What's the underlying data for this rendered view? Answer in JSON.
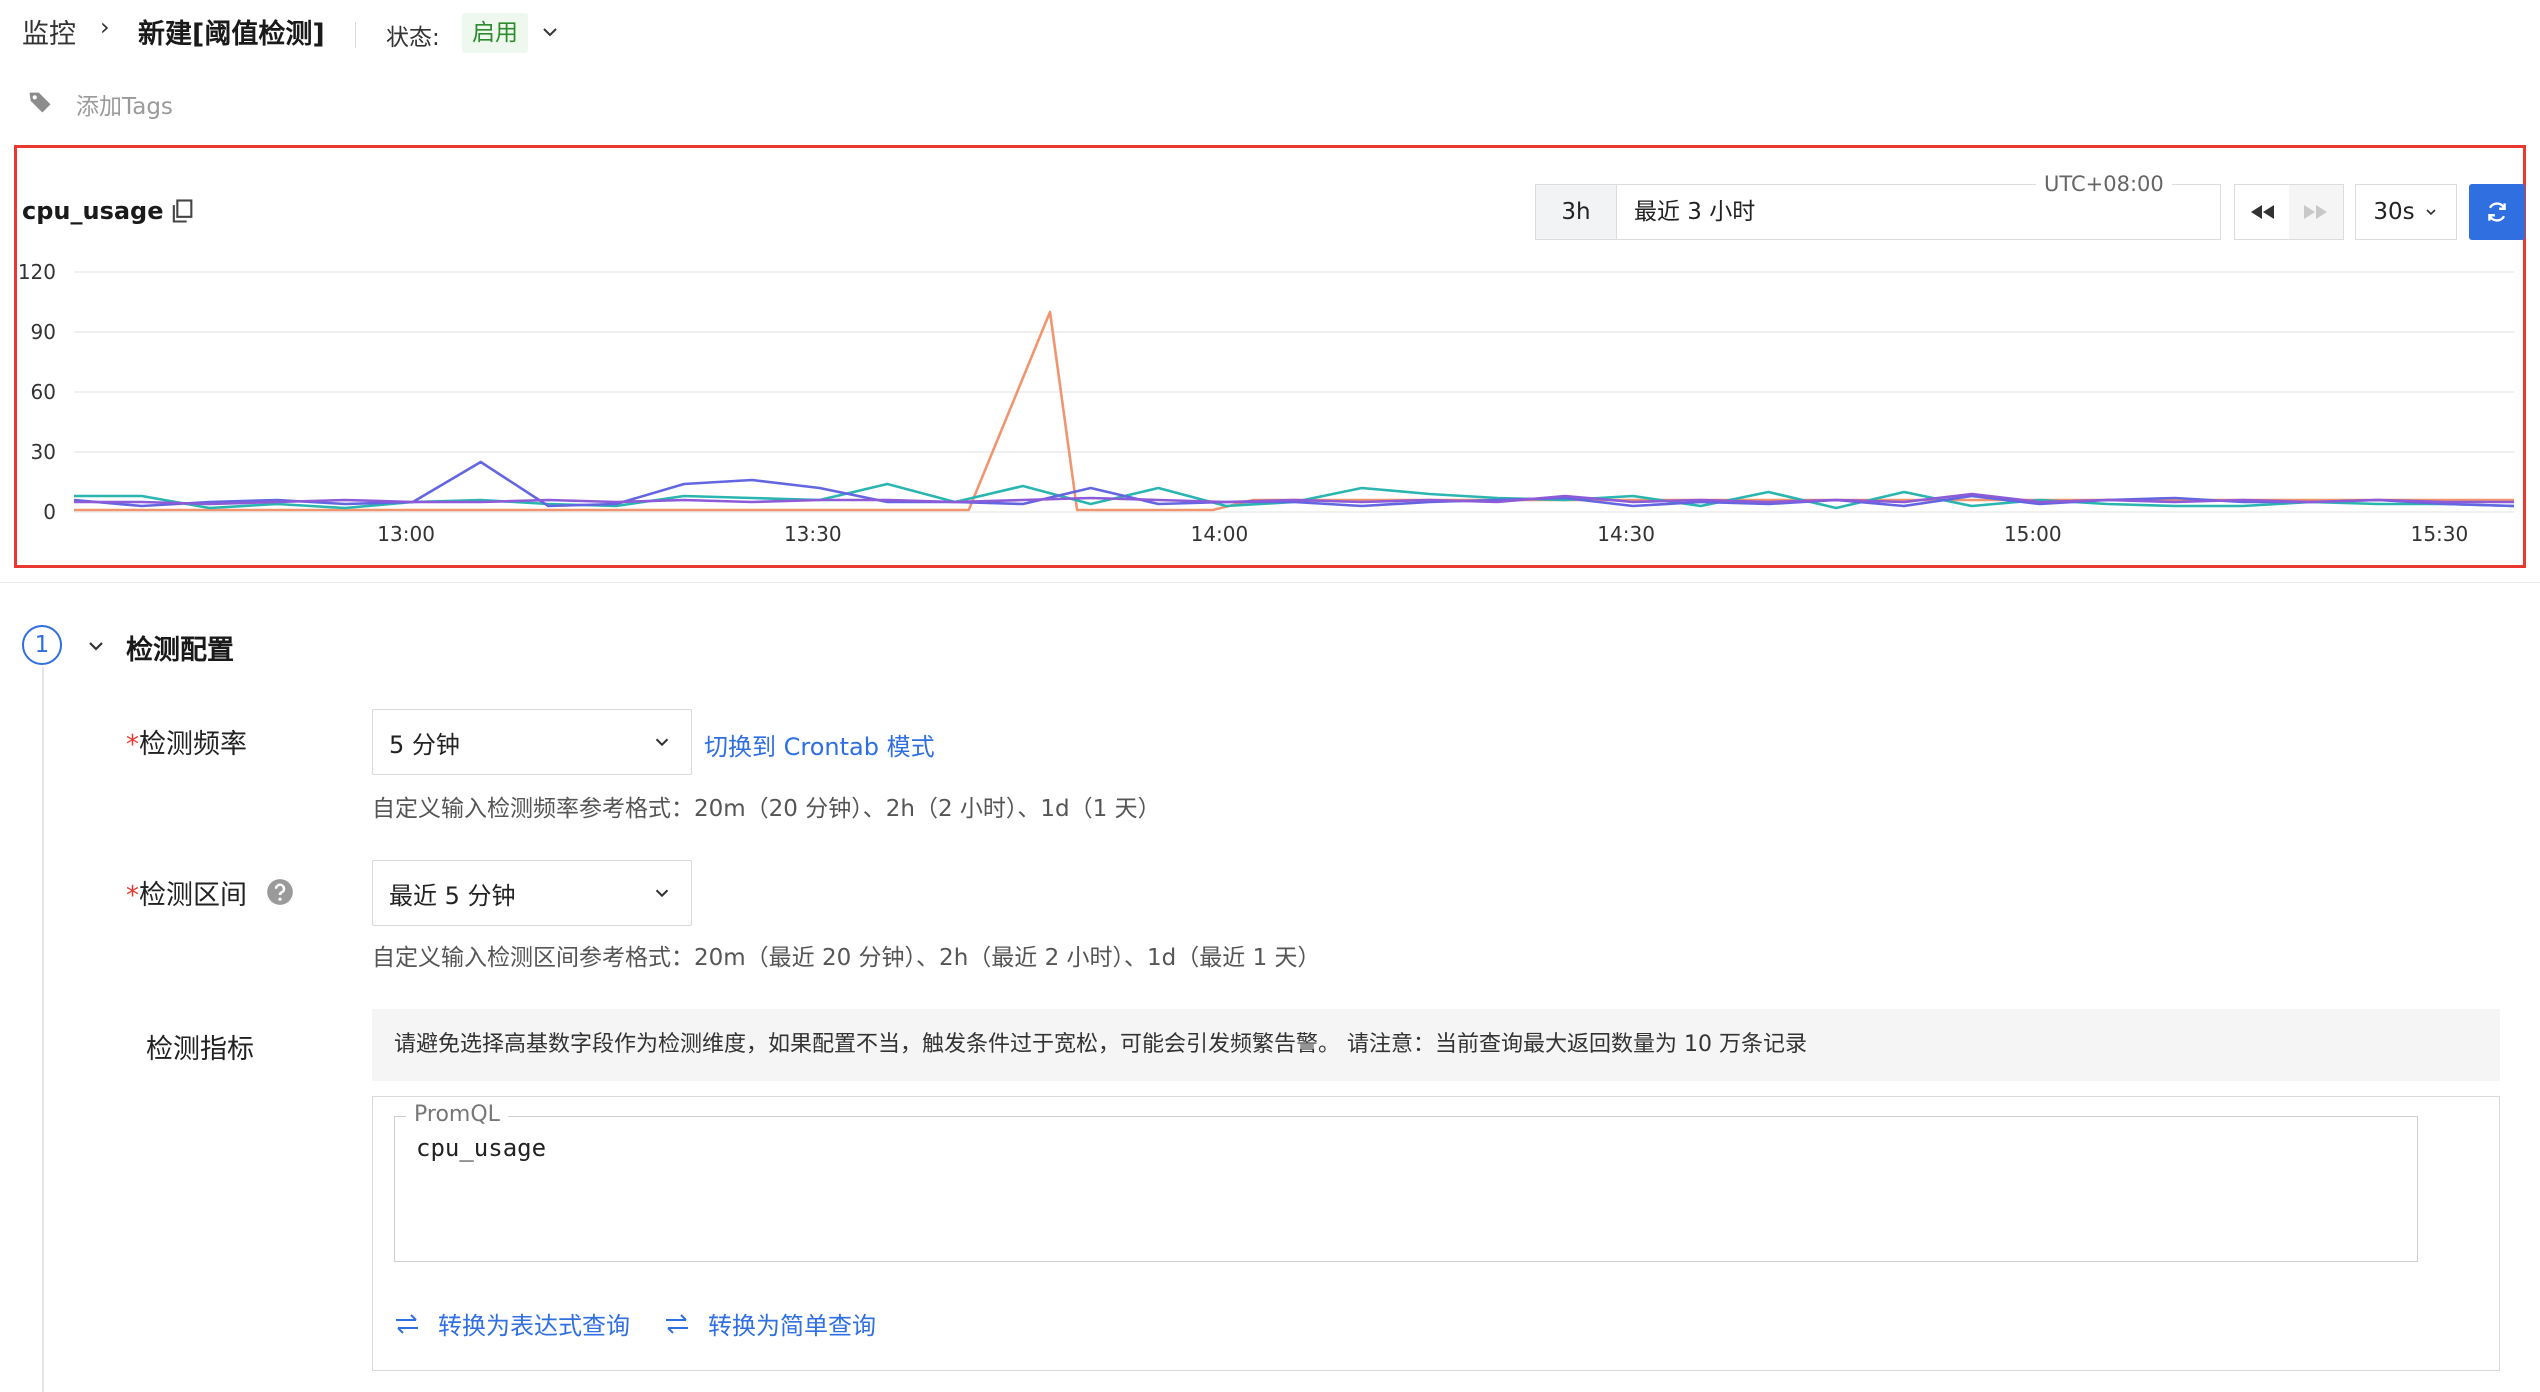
{
  "breadcrumb": {
    "root": "监控",
    "separator": "›",
    "title": "新建[阈值检测]"
  },
  "status": {
    "label": "状态:",
    "value": "启用"
  },
  "tags": {
    "add_label": "添加Tags"
  },
  "chart_panel": {
    "metric_name": "cpu_usage",
    "time_range": {
      "short": "3h",
      "text": "最近 3 小时",
      "timezone": "UTC+08:00"
    },
    "refresh_interval": "30s"
  },
  "colors": {
    "accent": "#2f6fe0",
    "highlight_border": "#e8382f",
    "series_orange": "#f0956f",
    "series_teal": "#2bb5b0",
    "series_indigo": "#6366e0",
    "series_purple": "#8d5ad8"
  },
  "chart_data": {
    "type": "line",
    "y_ticks": [
      "120",
      "90",
      "60",
      "30",
      "0"
    ],
    "ylim": [
      0,
      120
    ],
    "x_ticks": [
      "13:00",
      "13:30",
      "14:00",
      "14:30",
      "15:00",
      "15:30"
    ],
    "x_tick_values": [
      12.5,
      42.5,
      72.5,
      102.5,
      132.5,
      162.5
    ],
    "xlim": [
      -12,
      168
    ],
    "grid": true,
    "legend": "none",
    "series": [
      {
        "color": "#f0956f",
        "x": [
          -12,
          0,
          15,
          30,
          48,
          54,
          60,
          62,
          72,
          75,
          90,
          105,
          120,
          135,
          150,
          168
        ],
        "y": [
          1,
          1,
          1,
          1,
          1,
          1,
          100,
          1,
          1,
          6,
          6,
          6,
          6,
          6,
          6,
          6
        ]
      },
      {
        "color": "#2bb5b0",
        "x": [
          -12,
          -7,
          -2,
          3,
          8,
          13,
          18,
          23,
          28,
          33,
          38,
          43,
          48,
          53,
          58,
          63,
          68,
          73,
          78,
          83,
          88,
          93,
          98,
          103,
          108,
          113,
          118,
          123,
          128,
          133,
          138,
          143,
          148,
          153,
          158,
          163,
          168
        ],
        "y": [
          8,
          8,
          2,
          4,
          2,
          5,
          6,
          4,
          3,
          8,
          7,
          6,
          14,
          5,
          13,
          4,
          12,
          3,
          5,
          12,
          9,
          7,
          6,
          8,
          3,
          10,
          2,
          10,
          3,
          6,
          4,
          3,
          3,
          5,
          4,
          4,
          3
        ]
      },
      {
        "color": "#6366e0",
        "x": [
          -12,
          -7,
          -2,
          3,
          8,
          13,
          18,
          23,
          28,
          33,
          38,
          43,
          48,
          53,
          58,
          63,
          68,
          73,
          78,
          83,
          88,
          93,
          98,
          103,
          108,
          113,
          118,
          123,
          128,
          133,
          138,
          143,
          148,
          153,
          158,
          163,
          168
        ],
        "y": [
          6,
          3,
          5,
          6,
          4,
          5,
          25,
          3,
          4,
          14,
          16,
          12,
          5,
          5,
          4,
          12,
          4,
          5,
          5,
          3,
          5,
          6,
          7,
          3,
          5,
          4,
          6,
          3,
          8,
          4,
          6,
          7,
          5,
          5,
          6,
          4,
          3
        ]
      },
      {
        "color": "#8d5ad8",
        "x": [
          -12,
          -7,
          -2,
          3,
          8,
          13,
          18,
          23,
          28,
          33,
          38,
          43,
          48,
          53,
          58,
          63,
          68,
          73,
          78,
          83,
          88,
          93,
          98,
          103,
          108,
          113,
          118,
          123,
          128,
          133,
          138,
          143,
          148,
          153,
          158,
          163,
          168
        ],
        "y": [
          5,
          5,
          4,
          5,
          6,
          5,
          5,
          6,
          5,
          6,
          5,
          6,
          6,
          5,
          6,
          7,
          6,
          5,
          6,
          5,
          6,
          5,
          8,
          5,
          6,
          5,
          6,
          5,
          9,
          5,
          6,
          5,
          6,
          5,
          6,
          5,
          5
        ]
      }
    ]
  },
  "section": {
    "step_number": "1",
    "title": "检测配置",
    "frequency": {
      "label": "检测频率",
      "value": "5 分钟",
      "crontab_link": "切换到 Crontab 模式",
      "hint": "自定义输入检测频率参考格式：20m（20 分钟）、2h（2 小时）、1d（1 天）"
    },
    "range": {
      "label": "检测区间",
      "value": "最近 5 分钟",
      "hint": "自定义输入检测区间参考格式：20m（最近 20 分钟）、2h（最近 2 小时）、1d（最近 1 天）"
    },
    "metric": {
      "label": "检测指标",
      "warning": "请避免选择高基数字段作为检测维度，如果配置不当，触发条件过于宽松，可能会引发频繁告警。 请注意：当前查询最大返回数量为 10 万条记录",
      "promql_legend": "PromQL",
      "promql_value": "cpu_usage",
      "convert_expression": "转换为表达式查询",
      "convert_simple": "转换为简单查询"
    }
  }
}
